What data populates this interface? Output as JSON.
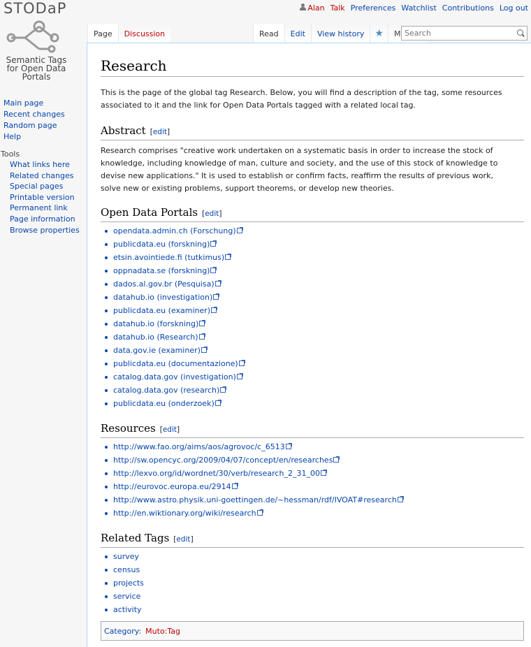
{
  "site": {
    "brand": "STODaP",
    "tagline": "Semantic Tags for Open Data Portals"
  },
  "personal": {
    "user": "Alan",
    "talk": "Talk",
    "preferences": "Preferences",
    "watchlist": "Watchlist",
    "contributions": "Contributions",
    "logout": "Log out"
  },
  "tabs": {
    "page": "Page",
    "discussion": "Discussion",
    "read": "Read",
    "edit": "Edit",
    "history": "View history",
    "more": "More"
  },
  "search": {
    "placeholder": "Search"
  },
  "sidebar": {
    "nav": [
      "Main page",
      "Recent changes",
      "Random page",
      "Help"
    ],
    "tools_heading": "Tools",
    "tools": [
      "What links here",
      "Related changes",
      "Special pages",
      "Printable version",
      "Permanent link",
      "Page information",
      "Browse properties"
    ]
  },
  "article": {
    "title": "Research",
    "intro": "This is the page of the global tag Research. Below, you will find a description of the tag, some resources associated to it and the link for Open Data Portals tagged with a related local tag.",
    "edit_label": "edit",
    "abstract_heading": "Abstract",
    "abstract_text": "Research comprises \"creative work undertaken on a systematic basis in order to increase the stock of knowledge, including knowledge of man, culture and society, and the use of this stock of knowledge to devise new applications.\" It is used to establish or confirm facts, reaffirm the results of previous work, solve new or existing problems, support theorems, or develop new theories.",
    "portals_heading": "Open Data Portals",
    "portals": [
      "opendata.admin.ch (Forschung)",
      "publicdata.eu (forskning)",
      "etsin.avointiede.fi (tutkimus)",
      "oppnadata.se (forskning)",
      "dados.al.gov.br (Pesquisa)",
      "datahub.io (investigation)",
      "publicdata.eu (examiner)",
      "datahub.io (forskning)",
      "datahub.io (Research)",
      "data.gov.ie (examiner)",
      "publicdata.eu (documentazione)",
      "catalog.data.gov (investigation)",
      "catalog.data.gov (research)",
      "publicdata.eu (onderzoek)"
    ],
    "resources_heading": "Resources",
    "resources": [
      "http://www.fao.org/aims/aos/agrovoc/c_6513",
      "http://sw.opencyc.org/2009/04/07/concept/en/researches",
      "http://lexvo.org/id/wordnet/30/verb/research_2_31_00",
      "http://eurovoc.europa.eu/2914",
      "http://www.astro.physik.uni-goettingen.de/~hessman/rdf/IVOAT#research",
      "http://en.wiktionary.org/wiki/research"
    ],
    "related_heading": "Related Tags",
    "related": [
      "survey",
      "census",
      "projects",
      "service",
      "activity"
    ],
    "category_label": "Category",
    "category_value": "Muto:Tag"
  }
}
